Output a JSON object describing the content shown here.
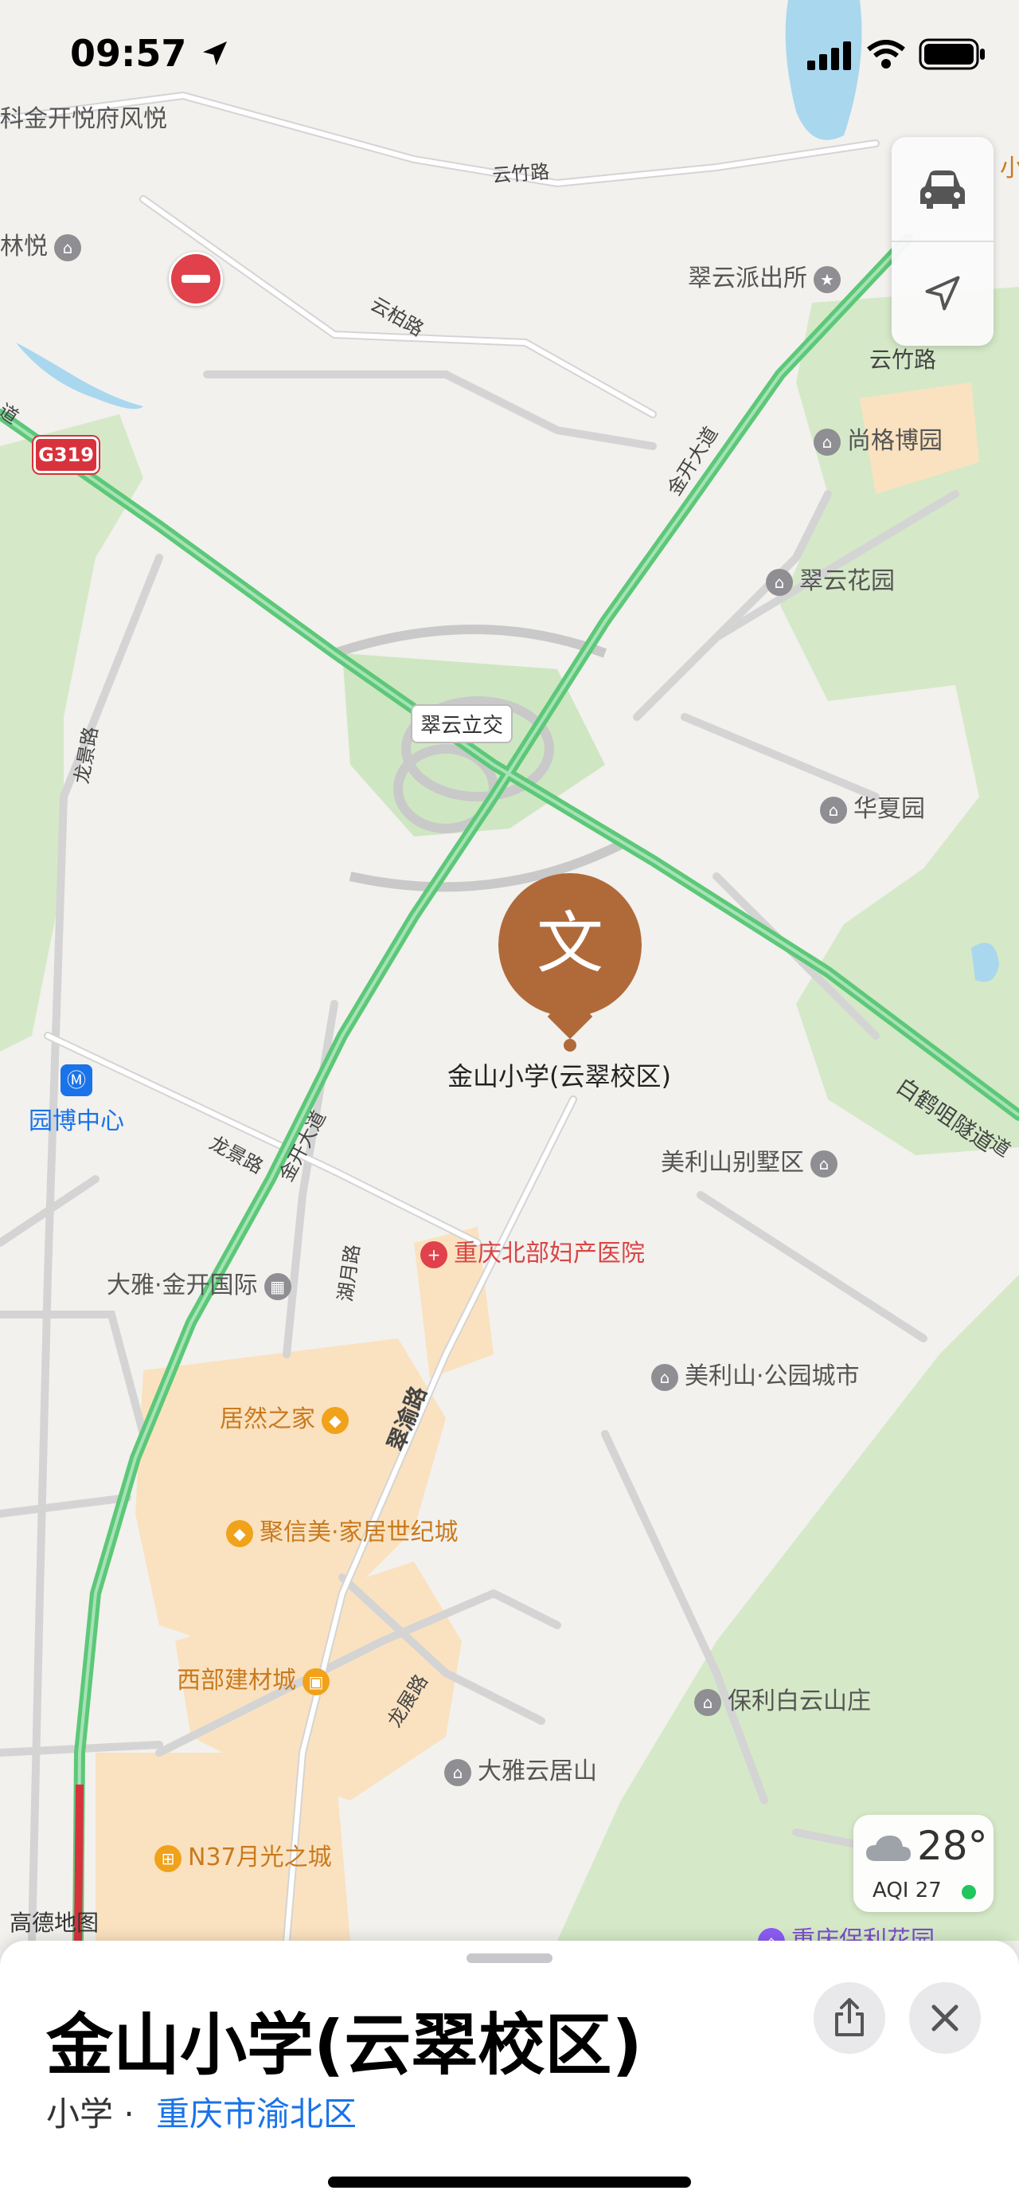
{
  "status_bar": {
    "time": "09:57"
  },
  "map": {
    "road_labels": [
      "云竹路",
      "云柏路",
      "云竹路",
      "金开大道",
      "龙景路",
      "龙景路",
      "金开大道",
      "湖月路",
      "翠渝路",
      "龙展路",
      "白鹤咀隧道",
      "道",
      "道"
    ],
    "highway_shield": "G319",
    "interchange_label": "翠云立交",
    "pois": [
      "科金开悦府风悦",
      "林悦",
      "翠云派出所",
      "尚格博园",
      "翠云花园",
      "华夏园",
      "美利山别墅区",
      "重庆北部妇产医院",
      "大雅·金开国际",
      "美利山·公园城市",
      "居然之家",
      "聚信美·家居世纪城",
      "西部建材城",
      "保利白云山庄",
      "大雅云居山",
      "N37月光之城",
      "重庆保利花园",
      "小"
    ],
    "metro_station": "园博中心",
    "selected_place_label": "金山小学(云翠校区)",
    "selected_pin_glyph": "文",
    "attribution": "高德地图",
    "colors": {
      "route_green": "#5cc878",
      "pin_brown": "#b06a3a",
      "park_green": "#cfe6c2",
      "commercial": "#fbe3c2",
      "water": "#a7d8f0"
    }
  },
  "controls": {
    "car_icon": "car-icon",
    "locate_icon": "location-arrow-icon"
  },
  "weather": {
    "temp": "28°",
    "aqi": "AQI 27"
  },
  "sheet": {
    "title": "金山小学(云翠校区)",
    "category": "小学 ·",
    "region": "重庆市渝北区",
    "share_icon": "share-icon",
    "close_icon": "close-icon"
  }
}
